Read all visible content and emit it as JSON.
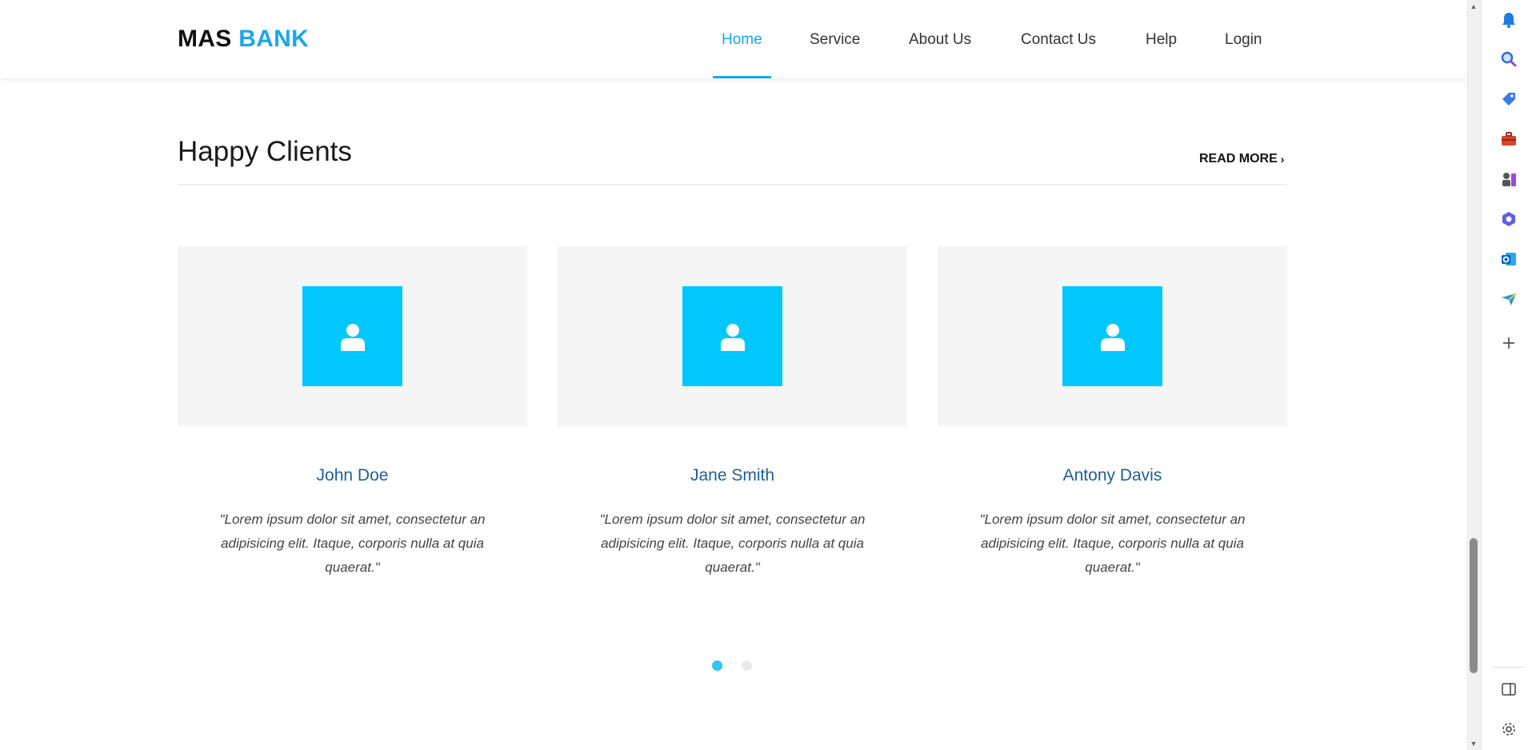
{
  "header": {
    "logo_part1": "MAS",
    "logo_part2": "BANK",
    "nav": [
      {
        "label": "Home",
        "active": true
      },
      {
        "label": "Service",
        "active": false
      },
      {
        "label": "About Us",
        "active": false
      },
      {
        "label": "Contact Us",
        "active": false
      },
      {
        "label": "Help",
        "active": false
      },
      {
        "label": "Login",
        "active": false
      }
    ]
  },
  "section": {
    "title": "Happy Clients",
    "read_more": "READ MORE"
  },
  "clients": [
    {
      "name": "John Doe",
      "quote": "\"Lorem ipsum dolor sit amet, consectetur an adipisicing elit. Itaque, corporis nulla at quia quaerat.\""
    },
    {
      "name": "Jane Smith",
      "quote": "\"Lorem ipsum dolor sit amet, consectetur an adipisicing elit. Itaque, corporis nulla at quia quaerat.\""
    },
    {
      "name": "Antony Davis",
      "quote": "\"Lorem ipsum dolor sit amet, consectetur an adipisicing elit. Itaque, corporis nulla at quia quaerat.\""
    }
  ],
  "carousel": {
    "pages": 2,
    "active_index": 0
  },
  "sidepanel": {
    "icons": [
      "bell-icon",
      "search-icon",
      "tag-icon",
      "toolbox-icon",
      "chess-icon",
      "copilot-icon",
      "outlook-icon",
      "send-icon",
      "add-icon",
      "split-view-icon",
      "settings-icon"
    ]
  },
  "colors": {
    "accent": "#1aa7ec",
    "avatar_bg": "#00c8ff",
    "name_color": "#1f5f96",
    "card_bg": "#f5f5f5"
  }
}
